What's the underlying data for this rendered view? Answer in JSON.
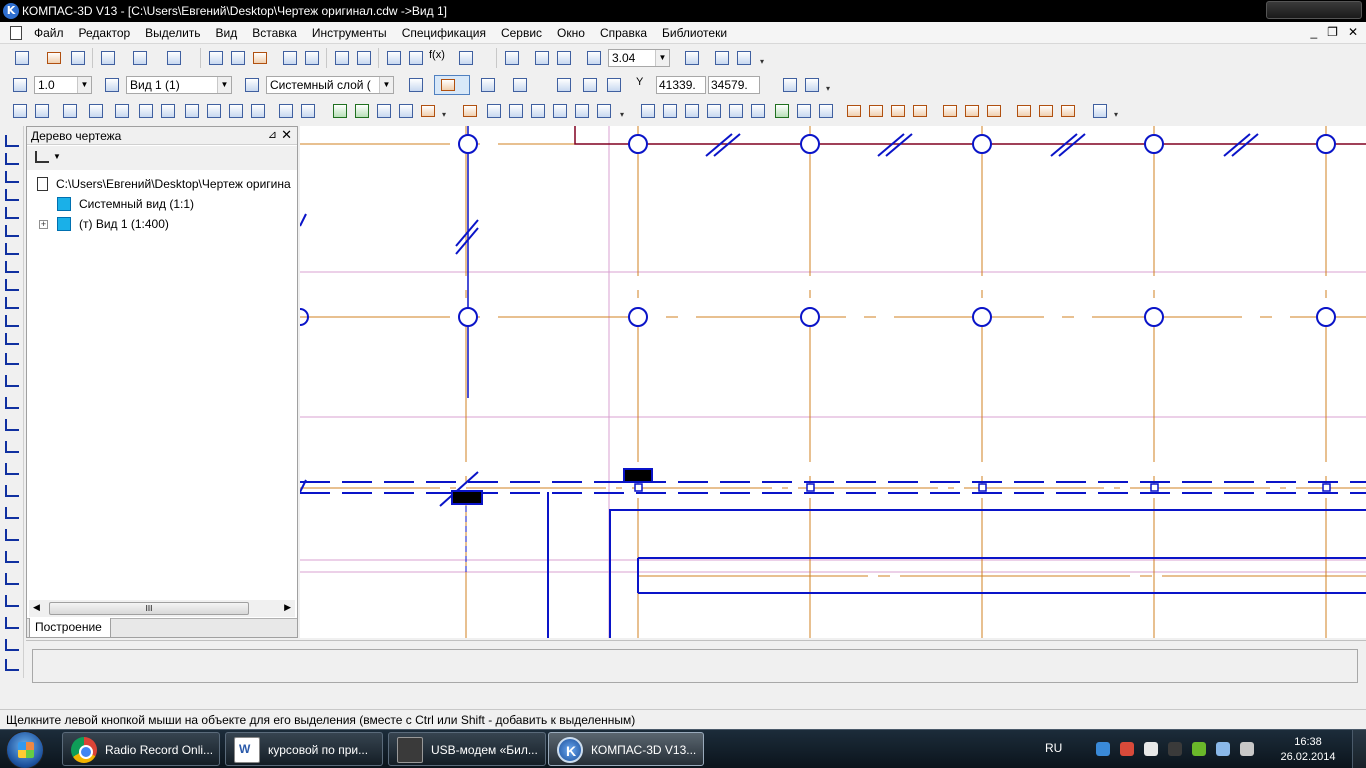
{
  "window": {
    "title": "КОМПАС-3D V13 - [C:\\Users\\Евгений\\Desktop\\Чертеж оригинал.cdw ->Вид 1]",
    "app_icon_letter": "K"
  },
  "menu": {
    "items": [
      "Файл",
      "Редактор",
      "Выделить",
      "Вид",
      "Вставка",
      "Инструменты",
      "Спецификация",
      "Сервис",
      "Окно",
      "Справка",
      "Библиотеки"
    ],
    "mdi": {
      "minimize": "_",
      "restore": "❐",
      "close": "✕"
    }
  },
  "toolbar_main": {
    "zoom_value": "3.04",
    "fx_label": "f(x)"
  },
  "toolbar_state": {
    "step_value": "1.0",
    "view_value": "Вид 1 (1)",
    "layer_value": "Системный слой (",
    "coord_label": "Y",
    "coord_x": "41339.",
    "coord_y": "34579."
  },
  "tree": {
    "title": "Дерево чертежа",
    "pin": "⊿",
    "close": "✕",
    "nodes": [
      {
        "label": "C:\\Users\\Евгений\\Desktop\\Чертеж оригина",
        "icon": "document-icon"
      },
      {
        "label": "Системный вид (1:1)",
        "icon": "view-icon"
      },
      {
        "label": "(т) Вид 1 (1:400)",
        "icon": "view-icon",
        "expander": "+"
      }
    ],
    "scroll_grip": "III",
    "tab": "Построение"
  },
  "status": {
    "hint": "Щелкните левой кнопкой мыши на объекте для его выделения (вместе с Ctrl или Shift - добавить к выделенным)"
  },
  "taskbar": {
    "items": [
      {
        "label": "Radio Record Onli...",
        "icon": "chrome-icon"
      },
      {
        "label": "курсовой по при...",
        "icon": "word-icon"
      },
      {
        "label": "USB-модем «Бил...",
        "icon": "modem-icon"
      },
      {
        "label": "КОМПАС-3D V13...",
        "icon": "kompas-icon",
        "active": true
      }
    ],
    "lang": "RU",
    "time": "16:38",
    "date": "26.02.2014"
  },
  "colors": {
    "axis_orange": "#d08020",
    "element_blue": "#0a14c8",
    "guide_pink": "#d8a0d0",
    "selection_dark_red": "#800020"
  }
}
